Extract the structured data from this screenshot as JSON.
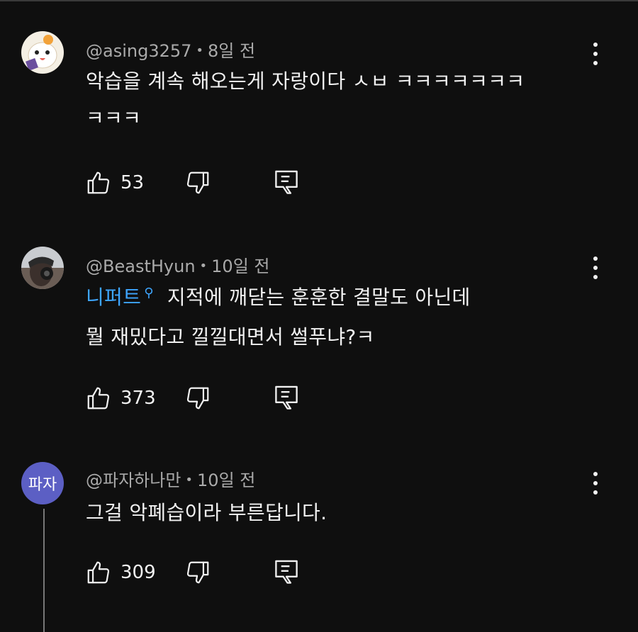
{
  "comments": [
    {
      "author": "@asing3257",
      "time": "8일 전",
      "lines": [
        "악습을 계속 해오는게 자랑이다 ㅅㅂ ㅋㅋㅋㅋㅋㅋㅋ",
        "ㅋㅋㅋ"
      ],
      "likes": "53"
    },
    {
      "author": "@BeastHyun",
      "time": "10일 전",
      "mention": "니퍼트",
      "lines": [
        "지적에 깨닫는 훈훈한 결말도 아닌데",
        "뭘 재밌다고 낄낄대면서 썰푸냐?ㅋ"
      ],
      "likes": "373"
    },
    {
      "author": "@파자하나만",
      "avatar_text": "파자",
      "time": "10일 전",
      "lines": [
        "그걸 악폐습이라 부른답니다."
      ],
      "likes": "309"
    }
  ],
  "separator": "•",
  "colors": {
    "background": "#0f0f0f",
    "text": "#f1f1f1",
    "meta": "#aaaaaa",
    "mention": "#3ea6ff",
    "avatar_3": "#5c5fc4"
  },
  "icons": [
    "thumbs-up-icon",
    "thumbs-down-icon",
    "reply-comment-icon",
    "more-vert-icon",
    "search-icon"
  ]
}
